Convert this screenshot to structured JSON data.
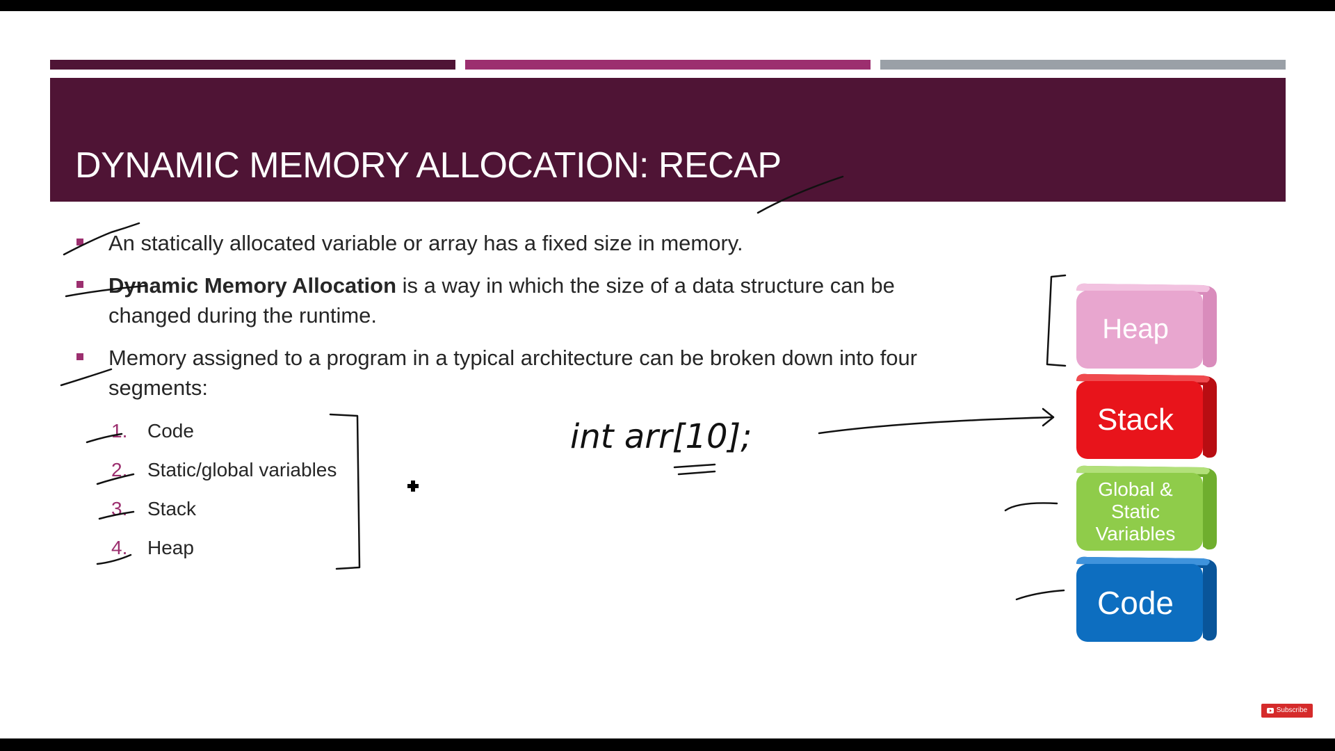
{
  "slide": {
    "title": "DYNAMIC MEMORY ALLOCATION: RECAP",
    "colors": {
      "title_band": "#4f1435",
      "accent": "#9c2f6f",
      "gray_bar": "#9aa0a7"
    },
    "bullets": [
      {
        "text": "An statically allocated variable or array has a fixed size in memory."
      },
      {
        "bold": "Dynamic Memory Allocation",
        "text": " is a way in which the size of a data structure can be changed during the runtime."
      },
      {
        "text": "Memory assigned to a program in a typical architecture can be broken down into four segments:"
      }
    ],
    "segments": [
      {
        "num": "1.",
        "label": "Code"
      },
      {
        "num": "2.",
        "label": "Static/global variables"
      },
      {
        "num": "3.",
        "label": "Stack"
      },
      {
        "num": "4.",
        "label": "Heap"
      }
    ],
    "handwritten_code": "int arr[10];",
    "memory_blocks": [
      {
        "label": "Heap",
        "color": "#e8a6cf"
      },
      {
        "label": "Stack",
        "color": "#e8141b"
      },
      {
        "label": "Global & Static Variables",
        "color": "#8fcc4a"
      },
      {
        "label": "Code",
        "color": "#0d6ec0"
      }
    ]
  },
  "player": {
    "subscribe_label": "Subscribe"
  }
}
